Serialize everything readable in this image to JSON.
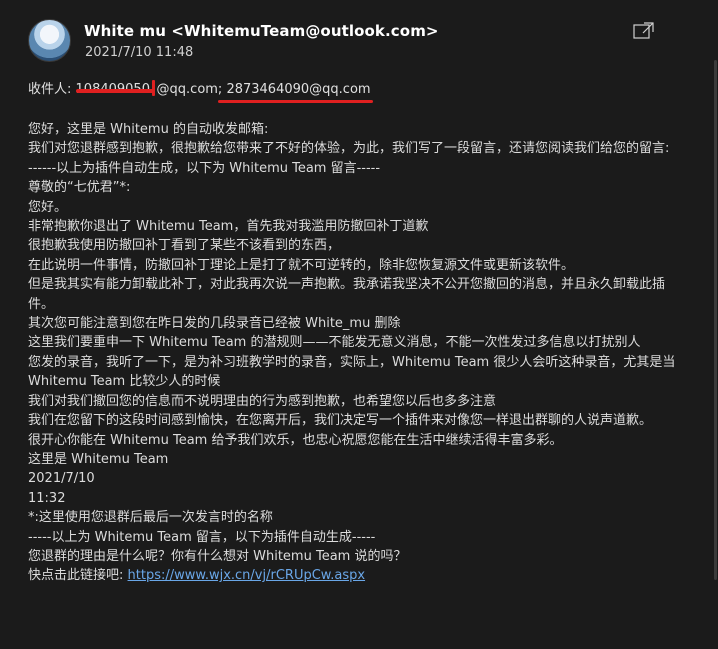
{
  "header": {
    "sender": "White mu <WhitemuTeam@outlook.com>",
    "date": "2021/7/10 11:48"
  },
  "recipients": {
    "label": "收件人:",
    "addr1_redacted": "108409050",
    "addr1_domain": "@qq.com;",
    "addr2": "2873464090@qq.com"
  },
  "body_lines": [
    "您好，这里是 Whitemu 的自动收发邮箱:",
    "我们对您退群感到抱歉，很抱歉给您带来了不好的体验，为此，我们写了一段留言，还请您阅读我们给您的留言:",
    "------以上为插件自动生成，以下为 Whitemu Team 留言-----",
    "尊敬的“七优君”*:",
    "您好。",
    "非常抱歉你退出了 Whitemu Team，首先我对我滥用防撤回补丁道歉",
    "很抱歉我使用防撤回补丁看到了某些不该看到的东西，",
    "在此说明一件事情，防撤回补丁理论上是打了就不可逆转的，除非您恢复源文件或更新该软件。",
    "但是我其实有能力卸载此补丁，对此我再次说一声抱歉。我承诺我坚决不公开您撤回的消息，并且永久卸载此插件。",
    "其次您可能注意到您在昨日发的几段录音已经被 White_mu 删除",
    "这里我们要重申一下 Whitemu Team 的潜规则——不能发无意义消息，不能一次性发过多信息以打扰别人",
    "您发的录音，我听了一下，是为补习班教学时的录音，实际上，Whitemu Team 很少人会听这种录音，尤其是当 Whitemu Team 比较少人的时候",
    "我们对我们撤回您的信息而不说明理由的行为感到抱歉，也希望您以后也多多注意",
    "我们在您留下的这段时间感到愉快，在您离开后，我们决定写一个插件来对像您一样退出群聊的人说声道歉。",
    "很开心你能在 Whitemu Team 给予我们欢乐，也忠心祝愿您能在生活中继续活得丰富多彩。",
    "这里是 Whitemu Team",
    "2021/7/10",
    "11:32",
    "*:这里使用您退群后最后一次发言时的名称",
    "-----以上为 Whitemu Team 留言，以下为插件自动生成-----",
    "您退群的理由是什么呢？你有什么想对 Whitemu Team 说的吗？"
  ],
  "link_line": {
    "prefix": "快点击此链接吧:",
    "url": "https://www.wjx.cn/vj/rCRUpCw.aspx"
  },
  "icons": {
    "avatar": "avatar-image",
    "popout": "popout-icon"
  }
}
